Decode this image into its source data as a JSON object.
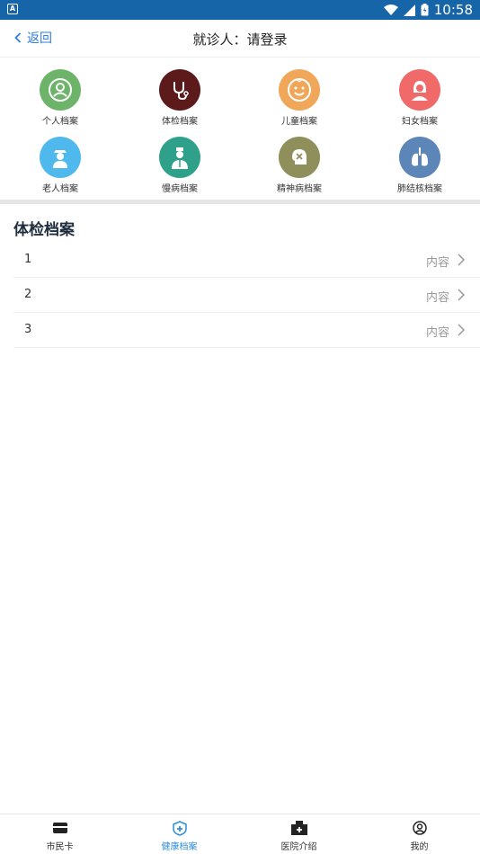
{
  "status_bar": {
    "time": "10:58",
    "left_badge": "A"
  },
  "header": {
    "back_label": "返回",
    "title": "就诊人：请登录"
  },
  "categories": [
    {
      "label": "个人档案",
      "color": "#6db36a",
      "icon": "person-icon"
    },
    {
      "label": "体检档案",
      "color": "#5c1a1a",
      "icon": "stethoscope-icon"
    },
    {
      "label": "儿童档案",
      "color": "#f0a75a",
      "icon": "baby-face-icon"
    },
    {
      "label": "妇女档案",
      "color": "#f06a6a",
      "icon": "woman-icon"
    },
    {
      "label": "老人档案",
      "color": "#4fb9ee",
      "icon": "elderly-icon"
    },
    {
      "label": "慢病档案",
      "color": "#2fa08a",
      "icon": "doctor-icon"
    },
    {
      "label": "精神病档案",
      "color": "#8f8f5c",
      "icon": "head-icon"
    },
    {
      "label": "肺结核档案",
      "color": "#5c86b8",
      "icon": "lungs-icon"
    }
  ],
  "section": {
    "title": "体检档案"
  },
  "records": [
    {
      "index": "1",
      "value": "内容"
    },
    {
      "index": "2",
      "value": "内容"
    },
    {
      "index": "3",
      "value": "内容"
    }
  ],
  "tabbar": {
    "active_color": "#2f8fd8",
    "items": [
      {
        "label": "市民卡",
        "icon": "card-icon"
      },
      {
        "label": "健康档案",
        "icon": "health-shield-icon"
      },
      {
        "label": "医院介绍",
        "icon": "hospital-icon"
      },
      {
        "label": "我的",
        "icon": "user-icon"
      }
    ]
  }
}
